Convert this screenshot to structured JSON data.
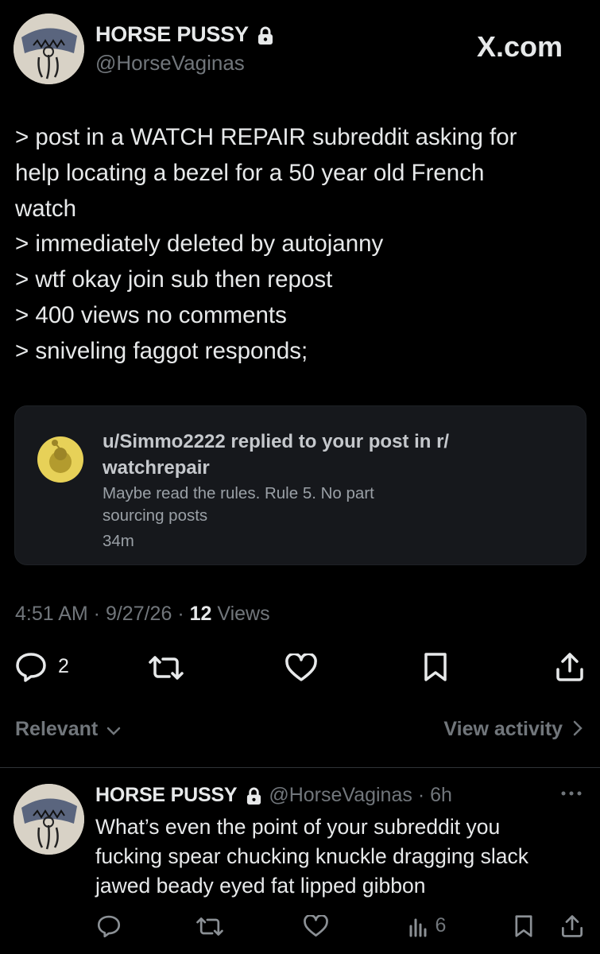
{
  "post": {
    "display_name": "HORSE PUSSY",
    "handle": "@HorseVaginas",
    "watermark": "X.com",
    "text": "> post in a WATCH REPAIR subreddit asking for\nhelp locating a bezel for a 50 year old French\nwatch\n> immediately deleted by autojanny\n> wtf okay join sub then repost\n> 400 views no comments\n> sniveling faggot responds;",
    "embedded_card": {
      "title": "u/Simmo2222 replied to your post in r/\nwatchrepair",
      "body": "Maybe read the rules. Rule 5. No part\nsourcing posts",
      "time": "34m",
      "icon": "reddit-avatar-icon"
    },
    "time": "4:51 AM",
    "date": "9/27/26",
    "views_count": "12",
    "views_label": "Views",
    "reply_count": "2"
  },
  "sort": {
    "label": "Relevant",
    "view_activity": "View activity"
  },
  "reply": {
    "display_name": "HORSE PUSSY",
    "handle": "@HorseVaginas",
    "age": "6h",
    "text": "What’s even the point of your subreddit you\nfucking spear chucking knuckle dragging slack\njawed beady eyed fat lipped gibbon",
    "views": "6"
  },
  "colors": {
    "background": "#000000",
    "text": "#e7e9ea",
    "muted": "#71767b",
    "card": "#16181c"
  }
}
